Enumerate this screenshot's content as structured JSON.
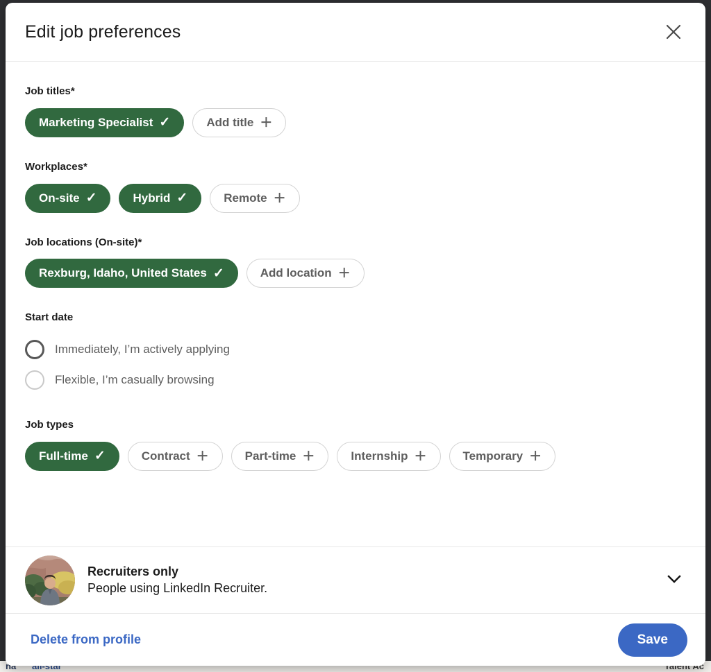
{
  "modal": {
    "title": "Edit job preferences",
    "close_icon": "close-icon"
  },
  "sections": {
    "job_titles": {
      "label": "Job titles",
      "required_marker": "*",
      "pills": [
        {
          "label": "Marketing Specialist",
          "state": "selected",
          "glyph": "✓"
        },
        {
          "label": "Add title",
          "state": "unselected",
          "glyph": "＋"
        }
      ]
    },
    "workplaces": {
      "label": "Workplaces",
      "required_marker": "*",
      "pills": [
        {
          "label": "On-site",
          "state": "selected",
          "glyph": "✓"
        },
        {
          "label": "Hybrid",
          "state": "selected",
          "glyph": "✓"
        },
        {
          "label": "Remote",
          "state": "unselected",
          "glyph": "＋"
        }
      ]
    },
    "job_locations": {
      "label": "Job locations (On-site)",
      "required_marker": "*",
      "pills": [
        {
          "label": "Rexburg, Idaho, United States",
          "state": "selected",
          "glyph": "✓"
        },
        {
          "label": "Add location",
          "state": "unselected",
          "glyph": "＋"
        }
      ]
    },
    "start_date": {
      "label": "Start date",
      "options": [
        {
          "label": "Immediately, I’m actively applying",
          "selected": false,
          "emphasized": true
        },
        {
          "label": "Flexible, I’m casually browsing",
          "selected": false,
          "emphasized": false
        }
      ]
    },
    "job_types": {
      "label": "Job types",
      "pills": [
        {
          "label": "Full-time",
          "state": "selected",
          "glyph": "✓"
        },
        {
          "label": "Contract",
          "state": "unselected",
          "glyph": "＋"
        },
        {
          "label": "Part-time",
          "state": "unselected",
          "glyph": "＋"
        },
        {
          "label": "Internship",
          "state": "unselected",
          "glyph": "＋"
        },
        {
          "label": "Temporary",
          "state": "unselected",
          "glyph": "＋"
        }
      ]
    }
  },
  "visibility": {
    "title": "Recruiters only",
    "subtitle": "People using LinkedIn Recruiter.",
    "avatar_name": "profile-avatar",
    "chevron_icon": "chevron-down-icon"
  },
  "footer": {
    "delete_label": "Delete from profile",
    "save_label": "Save"
  },
  "colors": {
    "selected_pill": "#31693f",
    "accent_blue": "#3b68c4",
    "text_primary": "#1b1b1b",
    "text_secondary": "#5e5e5e",
    "border": "#d3d3d3"
  },
  "background_page": {
    "fragment_left": "na",
    "fragment_link": "all-star",
    "fragment_right": "Talent Ac"
  }
}
